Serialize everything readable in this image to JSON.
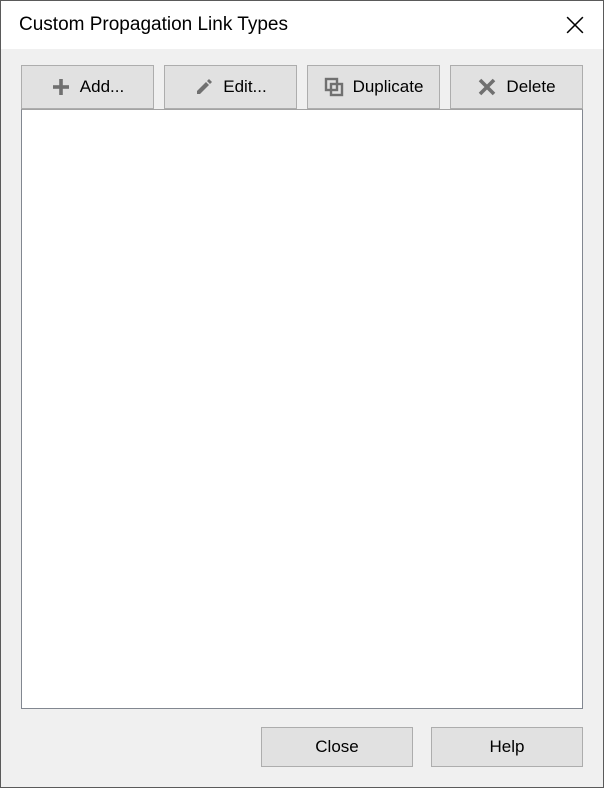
{
  "title": "Custom Propagation Link Types",
  "toolbar": {
    "add_label": "Add...",
    "edit_label": "Edit...",
    "duplicate_label": "Duplicate",
    "delete_label": "Delete"
  },
  "footer": {
    "close_label": "Close",
    "help_label": "Help"
  }
}
